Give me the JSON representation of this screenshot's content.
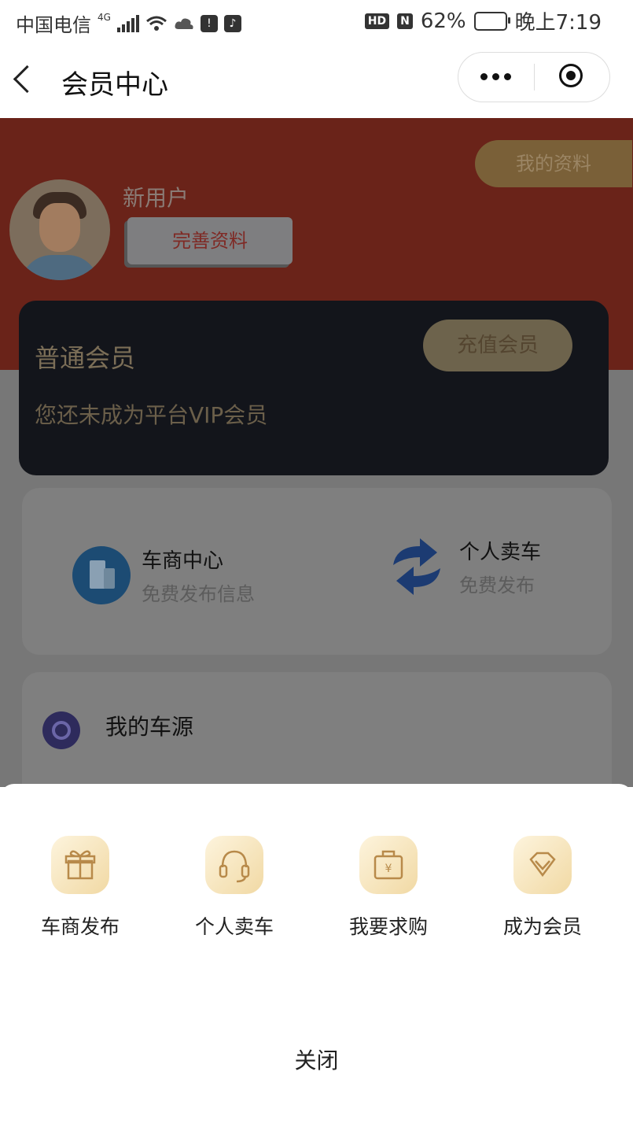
{
  "status_bar": {
    "carrier": "中国电信",
    "network": "4G",
    "battery": "62%",
    "time": "晚上7:19",
    "hd": "HD",
    "nfc": "N"
  },
  "nav": {
    "title": "会员中心"
  },
  "profile": {
    "username": "新用户",
    "complete_button": "完善资料",
    "my_profile_button": "我的资料"
  },
  "membership": {
    "level": "普通会员",
    "description": "您还未成为平台VIP会员",
    "recharge_button": "充值会员"
  },
  "entries": [
    {
      "title": "车商中心",
      "subtitle": "免费发布信息",
      "icon": "building-icon"
    },
    {
      "title": "个人卖车",
      "subtitle": "免费发布",
      "icon": "swap-arrows-icon"
    }
  ],
  "my_section": {
    "label": "我的车源",
    "icon": "search-icon"
  },
  "sheet": {
    "actions": [
      {
        "label": "车商发布",
        "icon": "gift-icon"
      },
      {
        "label": "个人卖车",
        "icon": "headset-icon"
      },
      {
        "label": "我要求购",
        "icon": "yen-bag-icon"
      },
      {
        "label": "成为会员",
        "icon": "diamond-icon"
      }
    ],
    "close_label": "关闭"
  },
  "colors": {
    "hero_red": "#c43a2a",
    "vip_card": "#1b1e26",
    "gold": "#c9a56a",
    "overlay": "rgba(0,0,0,0.5)"
  }
}
